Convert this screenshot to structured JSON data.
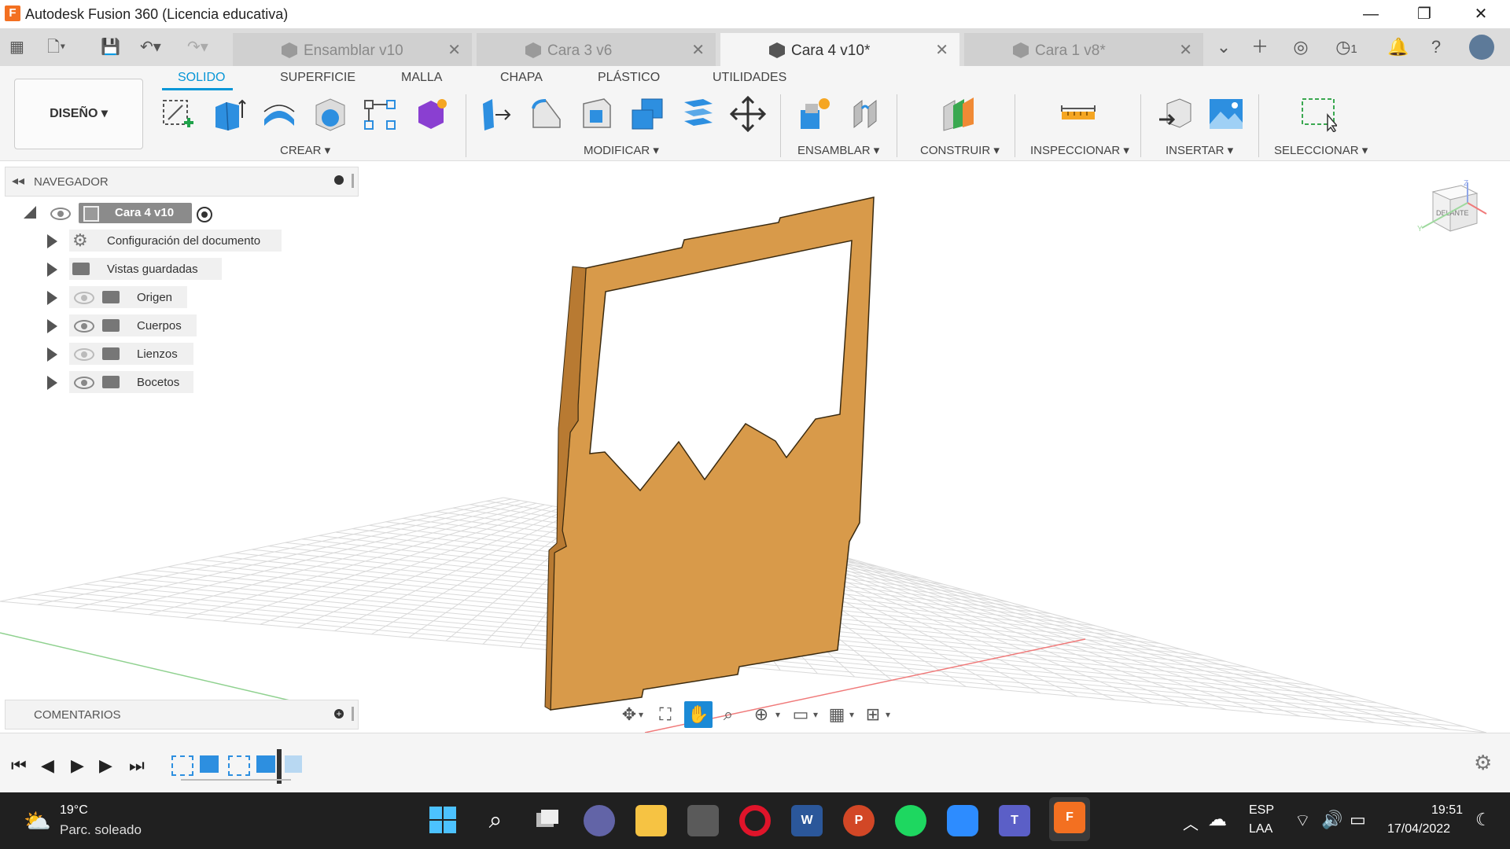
{
  "window": {
    "app_title": "Autodesk Fusion 360 (Licencia educativa)",
    "minimize": "—",
    "maximize": "❐",
    "close": "✕"
  },
  "tabs": [
    {
      "label": "Ensamblar v10",
      "active": false
    },
    {
      "label": "Cara 3 v6",
      "active": false
    },
    {
      "label": "Cara 4 v10*",
      "active": true
    },
    {
      "label": "Cara 1 v8*",
      "active": false
    }
  ],
  "header_right": {
    "jobs_count": "1"
  },
  "workspace_tabs": [
    "SOLIDO",
    "SUPERFICIE",
    "MALLA",
    "CHAPA",
    "PLÁSTICO",
    "UTILIDADES"
  ],
  "design_button": "DISEÑO ▾",
  "tool_groups": {
    "crear": "CREAR ▾",
    "modificar": "MODIFICAR ▾",
    "ensamblar": "ENSAMBLAR ▾",
    "construir": "CONSTRUIR ▾",
    "inspeccionar": "INSPECCIONAR ▾",
    "insertar": "INSERTAR ▾",
    "seleccionar": "SELECCIONAR ▾"
  },
  "navigator": {
    "title": "NAVEGADOR",
    "root": "Cara 4 v10",
    "items": [
      {
        "label": "Configuración del documento",
        "icon": "gear-icon"
      },
      {
        "label": "Vistas guardadas",
        "icon": "folder-icon"
      },
      {
        "label": "Origen",
        "icon": "folder-icon",
        "visibility": "hidden"
      },
      {
        "label": "Cuerpos",
        "icon": "folder-icon",
        "visibility": "visible"
      },
      {
        "label": "Lienzos",
        "icon": "folder-icon",
        "visibility": "hidden"
      },
      {
        "label": "Bocetos",
        "icon": "folder-icon",
        "visibility": "visible"
      }
    ]
  },
  "comments": {
    "title": "COMENTARIOS"
  },
  "viewcube": {
    "face": "DELANTE",
    "axis_z": "Z",
    "axis_y": "Y"
  },
  "colors": {
    "accent": "#0696d7",
    "body": "#d89a4a",
    "taskbar": "#202020"
  },
  "taskbar": {
    "weather_temp": "19°C",
    "weather_desc": "Parc. soleado",
    "lang_top": "ESP",
    "lang_bottom": "LAA",
    "time": "19:51",
    "date": "17/04/2022"
  }
}
